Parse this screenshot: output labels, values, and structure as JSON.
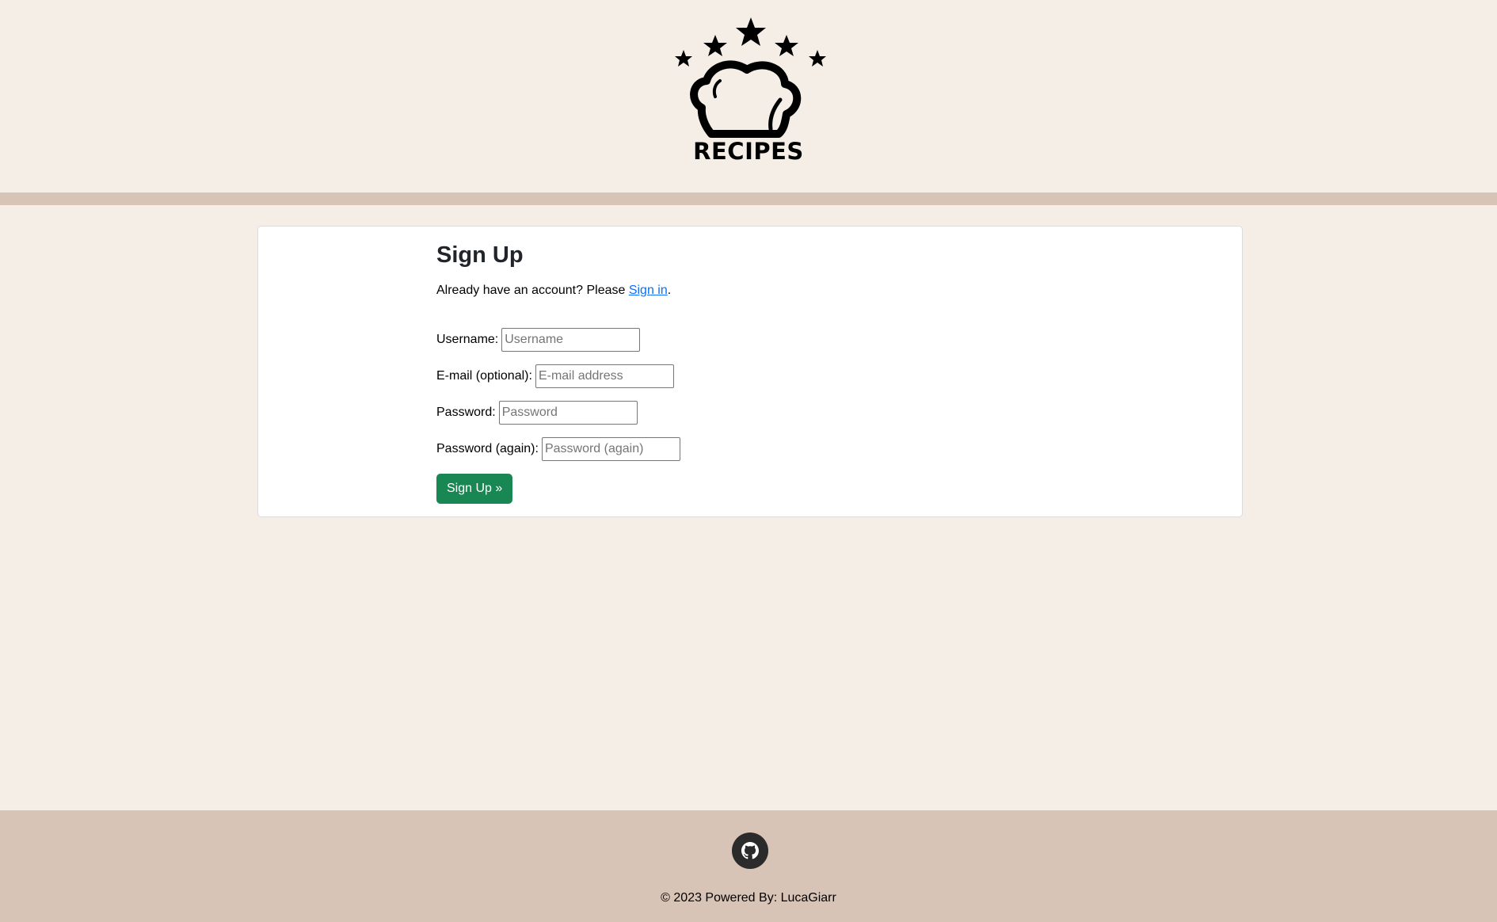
{
  "header": {
    "logo_text": "RECIPES"
  },
  "signup": {
    "title": "Sign Up",
    "intro_prefix": "Already have an account? Please ",
    "signin_link": "Sign in",
    "intro_suffix": ".",
    "fields": {
      "username": {
        "label": "Username:",
        "placeholder": "Username",
        "value": ""
      },
      "email": {
        "label": "E-mail (optional):",
        "placeholder": "E-mail address",
        "value": ""
      },
      "password": {
        "label": "Password:",
        "placeholder": "Password",
        "value": ""
      },
      "password_again": {
        "label": "Password (again):",
        "placeholder": "Password (again)",
        "value": ""
      }
    },
    "submit_label": "Sign Up »"
  },
  "footer": {
    "icon": "github-icon",
    "copyright": "© 2023 Powered By: LucaGiarr"
  },
  "colors": {
    "background": "#f5eee7",
    "accent_band": "#d8c4b6",
    "primary_button": "#198754",
    "link": "#0d6efd"
  }
}
